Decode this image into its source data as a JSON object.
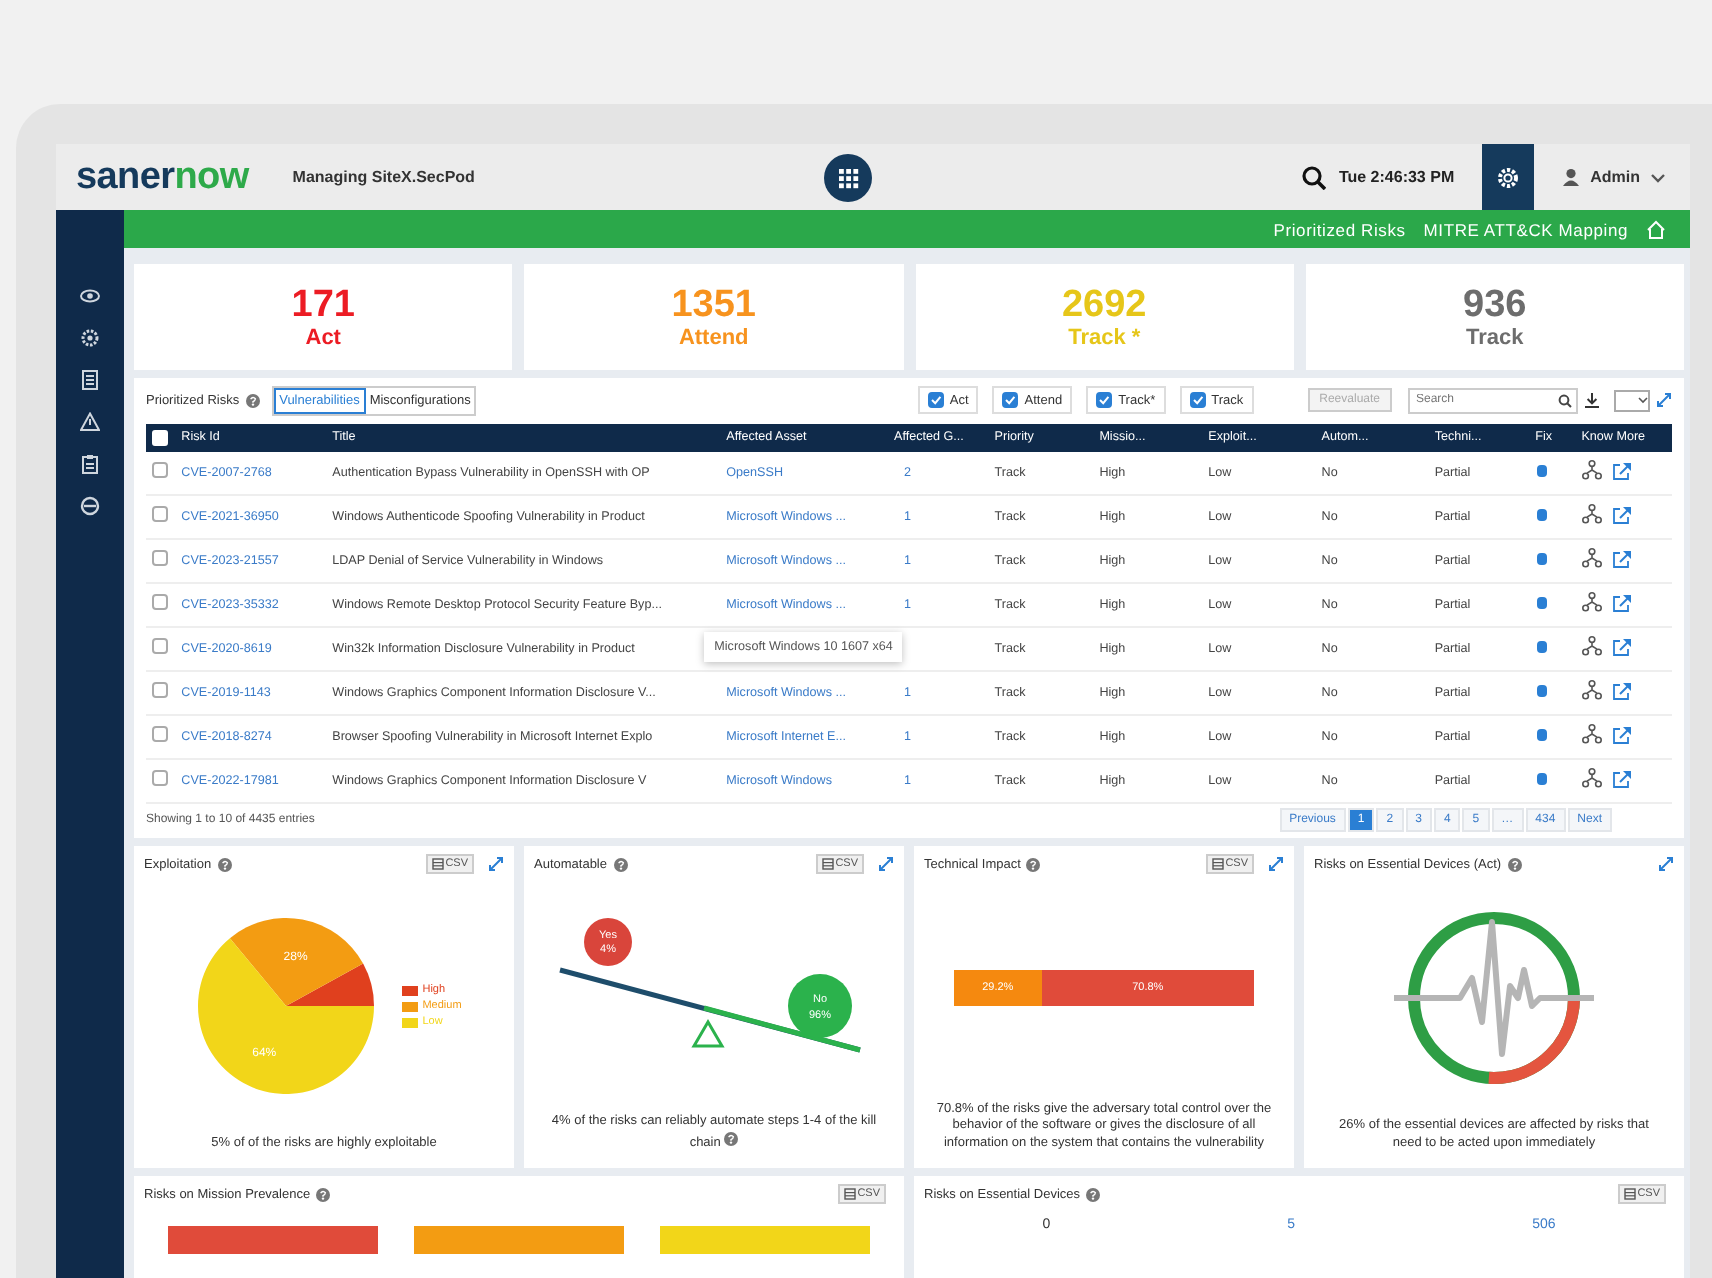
{
  "header": {
    "logo_left": "saner",
    "logo_right": "now",
    "managing": "Managing SiteX.SecPod",
    "time": "Tue 2:46:33 PM",
    "user": "Admin"
  },
  "nav_links": [
    "Prioritized Risks",
    "MITRE ATT&CK Mapping"
  ],
  "summary": [
    {
      "value": "171",
      "label": "Act",
      "color": "#ec1c24"
    },
    {
      "value": "1351",
      "label": "Attend",
      "color": "#f7931e"
    },
    {
      "value": "2692",
      "label": "Track *",
      "color": "#e6c619"
    },
    {
      "value": "936",
      "label": "Track",
      "color": "#6d6d6d"
    }
  ],
  "risks_panel": {
    "title": "Prioritized Risks",
    "tabs": [
      {
        "label": "Vulnerabilities",
        "selected": true
      },
      {
        "label": "Misconfigurations",
        "selected": false
      }
    ],
    "filters": [
      {
        "label": "Act",
        "checked": true
      },
      {
        "label": "Attend",
        "checked": true
      },
      {
        "label": "Track*",
        "checked": true
      },
      {
        "label": "Track",
        "checked": true
      }
    ],
    "reevaluate": {
      "label": "Reevaluate",
      "disabled": true
    },
    "search": {
      "placeholder": "Search"
    },
    "all_selected": false,
    "columns": [
      "Risk Id",
      "Title",
      "Affected Asset",
      "Affected G...",
      "Priority",
      "Missio...",
      "Exploit...",
      "Autom...",
      "Techni...",
      "Fix",
      "Know More"
    ],
    "rows": [
      {
        "id": "CVE-2007-2768",
        "title": "Authentication Bypass Vulnerability in OpenSSH with OP",
        "asset": "OpenSSH",
        "affected": "2",
        "priority": "Track",
        "mission": "High",
        "exploitation": "Low",
        "automatable": "No",
        "technical": "Partial",
        "checked": false
      },
      {
        "id": "CVE-2021-36950",
        "title": "Windows Authenticode Spoofing Vulnerability in Product",
        "asset": "Microsoft Windows ...",
        "affected": "1",
        "priority": "Track",
        "mission": "High",
        "exploitation": "Low",
        "automatable": "No",
        "technical": "Partial",
        "checked": false
      },
      {
        "id": "CVE-2023-21557",
        "title": "LDAP Denial of Service Vulnerability in Windows",
        "asset": "Microsoft Windows ...",
        "affected": "1",
        "priority": "Track",
        "mission": "High",
        "exploitation": "Low",
        "automatable": "No",
        "technical": "Partial",
        "checked": false
      },
      {
        "id": "CVE-2023-35332",
        "title": "Windows Remote Desktop Protocol Security Feature Byp...",
        "asset": "Microsoft Windows ...",
        "affected": "1",
        "priority": "Track",
        "mission": "High",
        "exploitation": "Low",
        "automatable": "No",
        "technical": "Partial",
        "checked": false
      },
      {
        "id": "CVE-2020-8619",
        "title": "Win32k Information Disclosure Vulnerability in Product",
        "tooltip": "Microsoft Windows 10 1607 x64",
        "priority": "Track",
        "mission": "High",
        "exploitation": "Low",
        "automatable": "No",
        "technical": "Partial",
        "checked": false
      },
      {
        "id": "CVE-2019-1143",
        "title": "Windows Graphics Component Information Disclosure V...",
        "asset": "Microsoft Windows ...",
        "affected": "1",
        "priority": "Track",
        "mission": "High",
        "exploitation": "Low",
        "automatable": "No",
        "technical": "Partial",
        "checked": false
      },
      {
        "id": "CVE-2018-8274",
        "title": "Browser Spoofing Vulnerability in Microsoft Internet Explo",
        "asset": "Microsoft Internet E...",
        "affected": "1",
        "priority": "Track",
        "mission": "High",
        "exploitation": "Low",
        "automatable": "No",
        "technical": "Partial",
        "checked": false
      },
      {
        "id": "CVE-2022-17981",
        "title": "Windows Graphics Component Information Disclosure V",
        "asset": "Microsoft Windows",
        "affected": "1",
        "priority": "Track",
        "mission": "High",
        "exploitation": "Low",
        "automatable": "No",
        "technical": "Partial",
        "checked": false
      }
    ],
    "footer": "Showing 1 to 10 of 4435 entries",
    "pagination": [
      {
        "label": "Previous",
        "selected": false
      },
      {
        "label": "1",
        "selected": true
      },
      {
        "label": "2",
        "selected": false
      },
      {
        "label": "3",
        "selected": false
      },
      {
        "label": "4",
        "selected": false
      },
      {
        "label": "5",
        "selected": false
      },
      {
        "label": "…",
        "selected": false
      },
      {
        "label": "434",
        "selected": false
      },
      {
        "label": "Next",
        "selected": false
      }
    ]
  },
  "exploitation": {
    "title": "Exploitation",
    "csv": "CSV",
    "legend": [
      {
        "color": "#e0401e"
      },
      {
        "color": "#f39c12"
      },
      {
        "color": "#f2d619"
      }
    ],
    "chart_data": {
      "type": "pie",
      "categories": [
        "High",
        "Medium",
        "Low"
      ],
      "series": [
        {
          "values": [
            8,
            28,
            64
          ]
        }
      ],
      "value_labels": [
        null,
        "28%",
        "64%"
      ]
    },
    "caption": "5% of of the risks are highly exploitable"
  },
  "automatable": {
    "title": "Automatable",
    "csv": "CSV",
    "yes": {
      "label": "Yes",
      "value": "4%"
    },
    "no": {
      "label": "No",
      "value": "96%"
    },
    "caption": "4% of the risks can reliably automate steps 1-4 of the kill chain"
  },
  "technical_impact": {
    "title": "Technical Impact",
    "csv": "CSV",
    "level": 0.292,
    "labels": [
      "29.2%",
      "70.8%"
    ],
    "caption": "70.8% of the risks give the adversary total control over the behavior of the software or gives the disclosure of all information on the system that contains the vulnerability"
  },
  "essential_act": {
    "title": "Risks on Essential Devices (Act)",
    "level": 0.26,
    "caption": "26% of the essential devices are affected by risks that need to be acted upon immediately"
  },
  "mission_prevalence": {
    "title": "Risks on Mission Prevalence",
    "csv": "CSV",
    "bars": [
      {
        "color": "#e04b3a"
      },
      {
        "color": "#f39c12"
      },
      {
        "color": "#f2d619"
      }
    ]
  },
  "essential_devices": {
    "title": "Risks on Essential Devices",
    "csv": "CSV",
    "values": [
      "0",
      "5",
      "506"
    ]
  }
}
